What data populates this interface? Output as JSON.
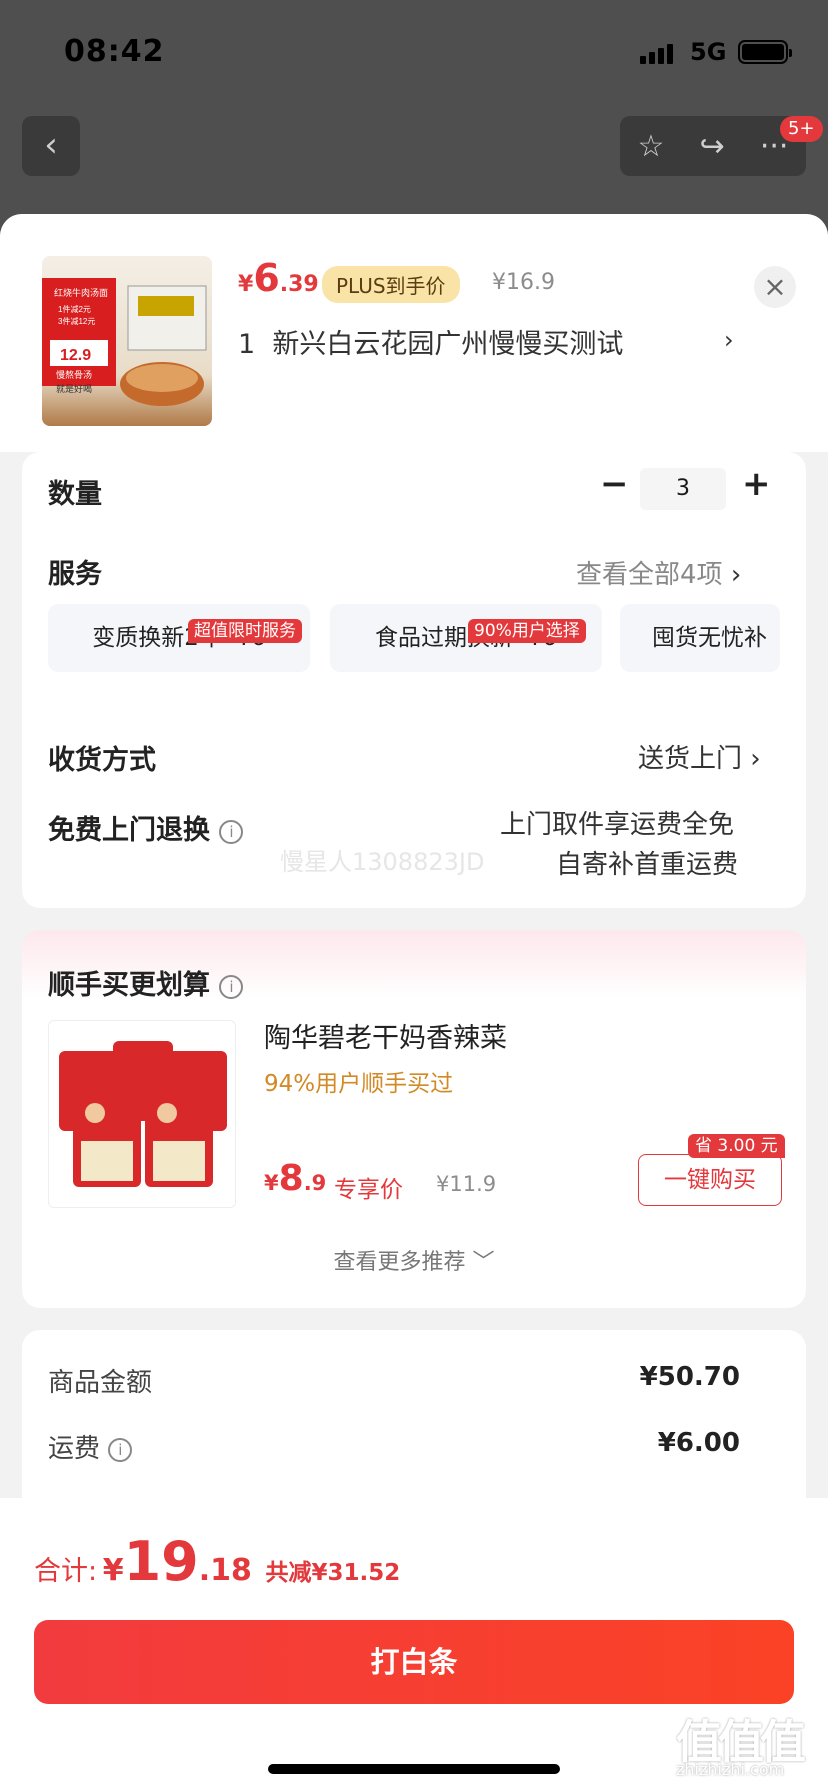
{
  "status_bar": {
    "time": "08:42",
    "network": "5G"
  },
  "nav": {
    "back_icon": "‹",
    "star_icon": "☆",
    "share_icon": "↪",
    "more_icon": "···",
    "badge": "5+"
  },
  "product": {
    "price_currency": "¥",
    "price_int": "6",
    "price_dec": ".39",
    "plus_label": "PLUS到手价",
    "original_price": "¥16.9",
    "address_index": "1",
    "address": "新兴白云花园广州慢慢买测试",
    "image_texts": [
      "红烧牛肉汤面",
      "1件减2元",
      "3件减12元",
      "12.9",
      "慢熬骨汤",
      "就是好喝"
    ]
  },
  "quantity": {
    "label": "数量",
    "minus": "−",
    "value": "3",
    "plus": "+"
  },
  "service": {
    "label": "服务",
    "view_all": "查看全部4项",
    "items": [
      {
        "name": "变质换新2年",
        "price": "¥6",
        "tag": "超值限时服务"
      },
      {
        "name": "食品过期换新",
        "price": "¥6",
        "tag": "90%用户选择"
      },
      {
        "name": "囤货无忧补",
        "price": "",
        "tag": ""
      }
    ]
  },
  "delivery": {
    "label": "收货方式",
    "value": "送货上门"
  },
  "free_return": {
    "label": "免费上门退换",
    "line1": "上门取件享运费全免",
    "line2": "自寄补首重运费"
  },
  "watermark": "慢星人1308823JD",
  "recommend": {
    "title": "顺手买更划算",
    "item_name": "陶华碧老干妈香辣菜",
    "item_sub": "94%用户顺手买过",
    "price_currency": "¥",
    "price_int": "8",
    "price_dec": ".9",
    "price_tag": "专享价",
    "original_price": "¥11.9",
    "save_tag": "省 3.00 元",
    "buy_label": "一键购买",
    "more_label": "查看更多推荐",
    "more_icon": "﹀"
  },
  "summary": {
    "goods_label": "商品金额",
    "goods_value": "¥50.70",
    "shipping_label": "运费",
    "shipping_value": "¥6.00"
  },
  "footer": {
    "total_label": "合计:",
    "total_currency": "¥",
    "total_int": "19",
    "total_dec": ".18",
    "discount": "共减¥31.52",
    "pay_label": "打白条"
  },
  "site_watermark": {
    "logo": "值值值",
    "url": "zhizhizhi.com"
  },
  "colors": {
    "accent": "#e4393c",
    "plus_bg": "#f9e3a6",
    "recommend_sub": "#d28a26"
  }
}
